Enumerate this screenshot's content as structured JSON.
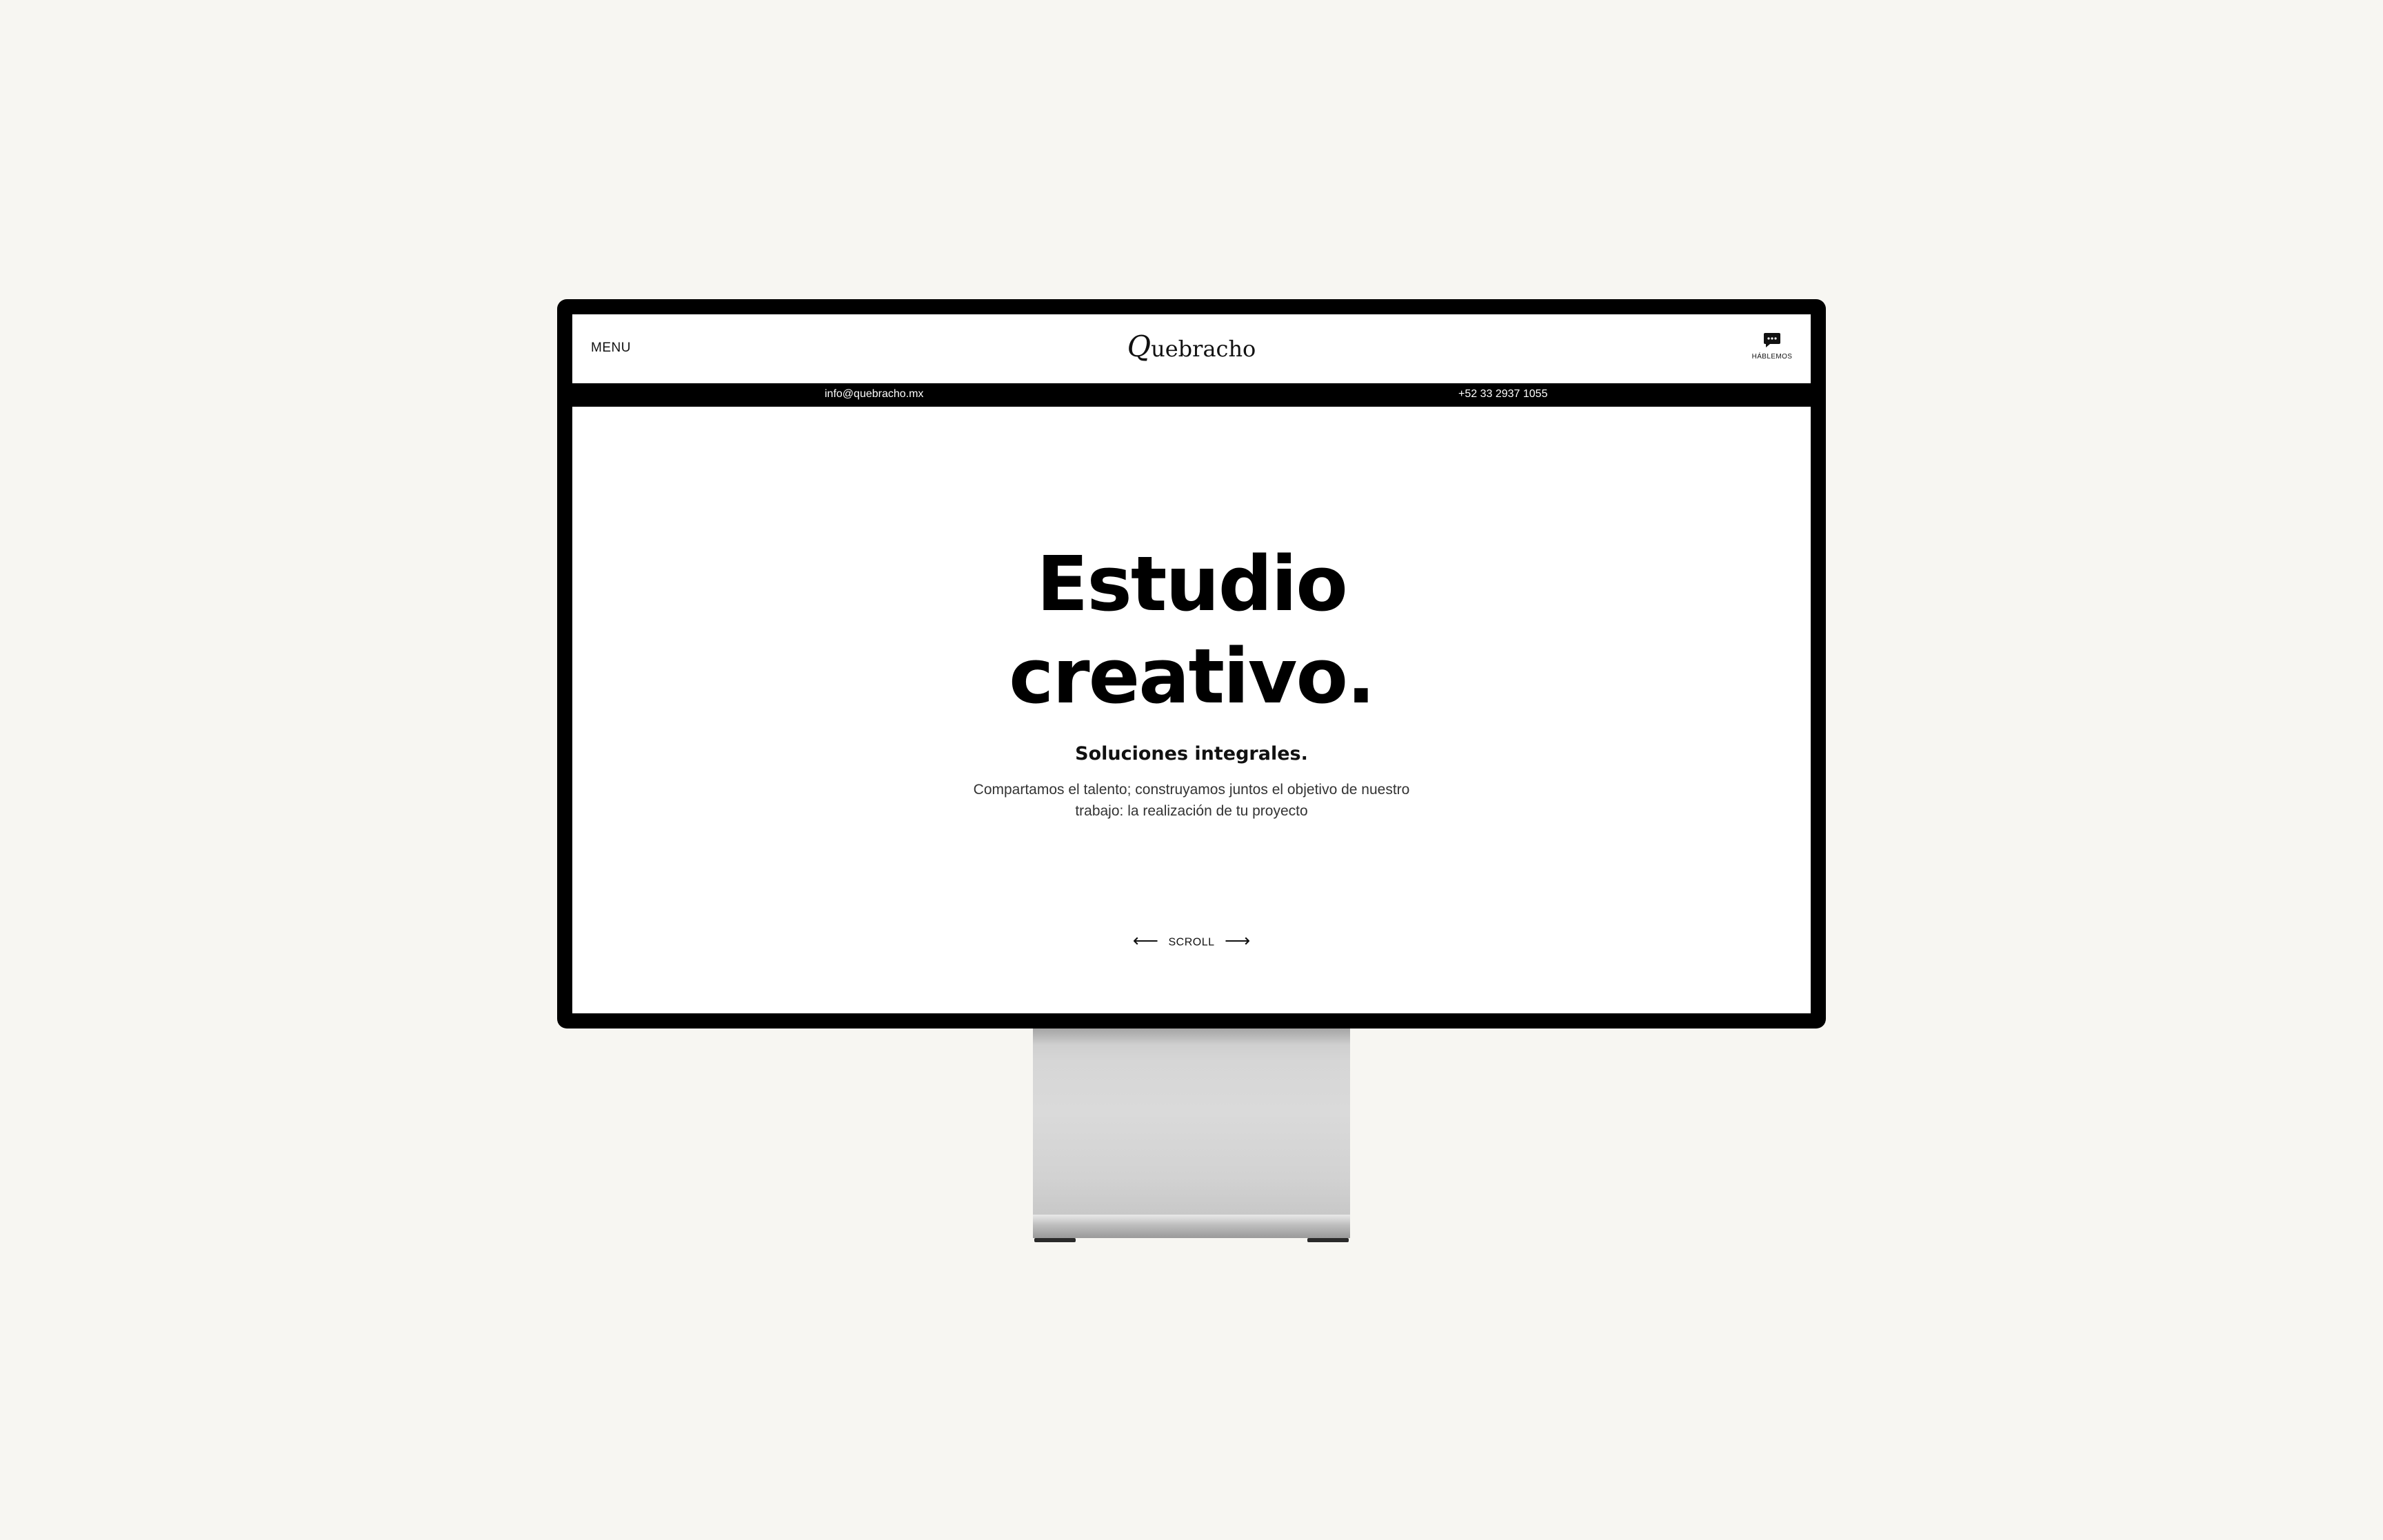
{
  "header": {
    "menu_label": "MENU",
    "logo_initial": "Q",
    "logo_rest": "uebracho",
    "talk_label": "HÁBLEMOS",
    "talk_icon": "chat-bubble-icon"
  },
  "contact": {
    "email": "info@quebracho.mx",
    "phone": "+52 33 2937 1055"
  },
  "hero": {
    "title_line1": "Estudio",
    "title_line2": "creativo.",
    "subtitle": "Soluciones integrales.",
    "description": "Compartamos el talento; construyamos juntos el objetivo de nuestro trabajo: la realización de tu proyecto"
  },
  "scroll": {
    "label": "SCROLL",
    "left_arrow": "⟵",
    "right_arrow": "⟶"
  },
  "colors": {
    "background": "#f7f6f2",
    "bezel": "#000000",
    "screen": "#ffffff",
    "text": "#000000"
  }
}
